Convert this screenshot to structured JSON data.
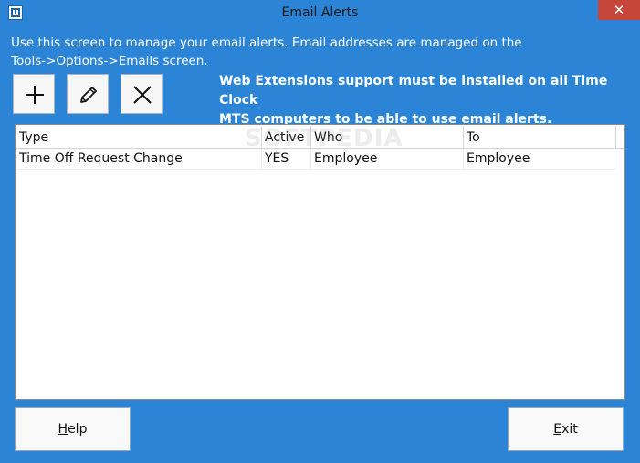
{
  "window": {
    "title": "Email Alerts",
    "close_glyph": "✕"
  },
  "description": {
    "line1": "Use this screen to manage your email alerts.  Email addresses are managed on the",
    "line2": "Tools->Options->Emails screen."
  },
  "toolbar": {
    "add_icon": "plus-icon",
    "edit_icon": "pencil-icon",
    "delete_icon": "x-icon"
  },
  "notice": {
    "line1": "Web Extensions support must be installed on all Time Clock",
    "line2": "MTS computers to be able to use email alerts."
  },
  "table": {
    "columns": [
      "Type",
      "Active",
      "Who",
      "To"
    ],
    "rows": [
      [
        "Time Off Request Change",
        "YES",
        "Employee",
        "Employee"
      ]
    ]
  },
  "watermark": "SOFTPEDIA",
  "buttons": {
    "help": {
      "mnemonic": "H",
      "rest": "elp"
    },
    "exit": {
      "mnemonic": "E",
      "rest": "xit"
    }
  },
  "colors": {
    "window_bg": "#2b84d6",
    "close_bg": "#c7463c"
  }
}
